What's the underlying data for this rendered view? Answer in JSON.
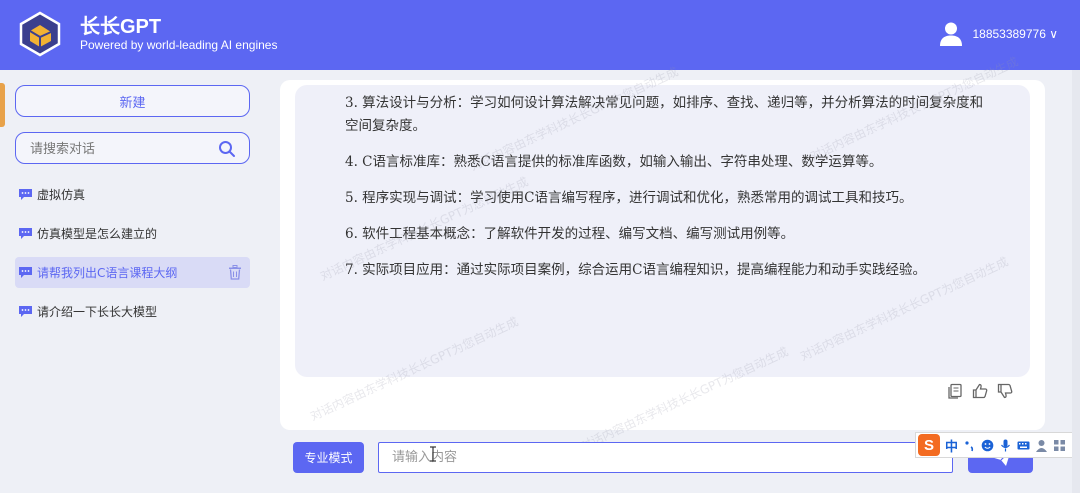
{
  "app": {
    "name": "长长GPT",
    "tagline": "Powered by world-leading AI engines",
    "user_label": "18853389776 ∨"
  },
  "sidebar": {
    "new_label": "新建",
    "search_placeholder": "请搜索对话",
    "conversations": [
      {
        "label": "虚拟仿真",
        "active": false
      },
      {
        "label": "仿真模型是怎么建立的",
        "active": false
      },
      {
        "label": "请帮我列出C语言课程大纲",
        "active": true
      },
      {
        "label": "请介绍一下长长大模型",
        "active": false
      }
    ]
  },
  "message": {
    "paragraphs": [
      "3. 算法设计与分析：学习如何设计算法解决常见问题，如排序、查找、递归等，并分析算法的时间复杂度和空间复杂度。",
      "4. C语言标准库：熟悉C语言提供的标准库函数，如输入输出、字符串处理、数学运算等。",
      "5. 程序实现与调试：学习使用C语言编写程序，进行调试和优化，熟悉常用的调试工具和技巧。",
      "6. 软件工程基本概念：了解软件开发的过程、编写文档、编写测试用例等。",
      "7. 实际项目应用：通过实际项目案例，综合运用C语言编程知识，提高编程能力和动手实践经验。"
    ]
  },
  "watermark": "对话内容由东学科技长长GPT为您自动生成",
  "input_bar": {
    "mode_label": "专业模式",
    "placeholder": "请输入内容"
  },
  "ime": {
    "logo": "S",
    "lang": "中"
  },
  "colors": {
    "accent": "#5c67f2",
    "sidebar_bg": "#eef0f6",
    "bubble_bg": "#eff0f9"
  }
}
